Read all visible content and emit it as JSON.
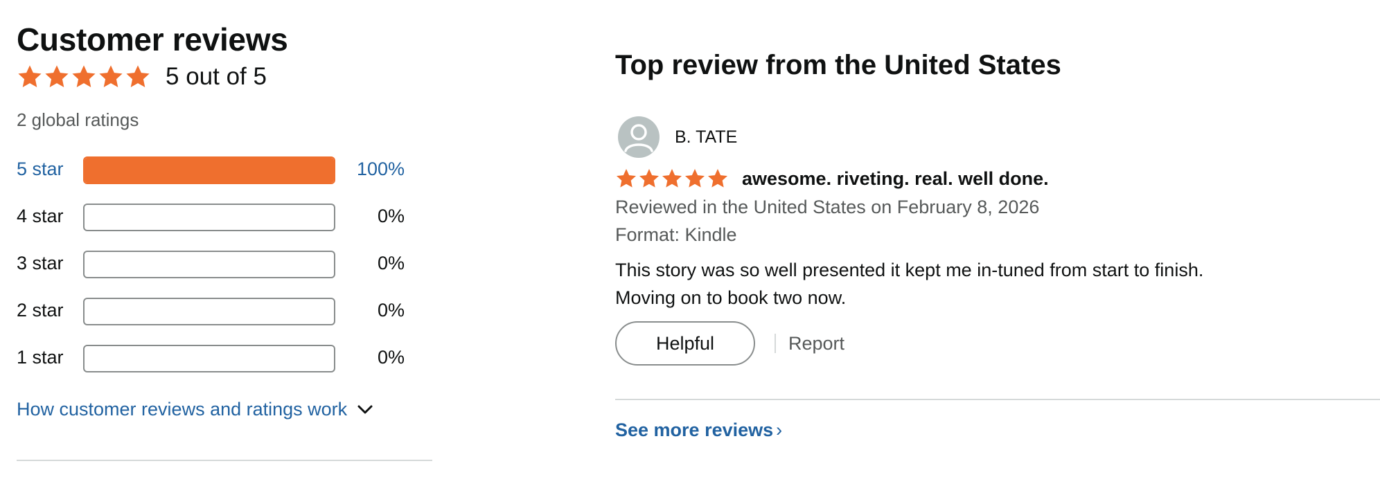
{
  "summary": {
    "title": "Customer reviews",
    "rating_value": 5,
    "rating_max": 5,
    "rating_text": "5 out of 5",
    "global_ratings": "2 global ratings",
    "star_color": "#ef6f2e"
  },
  "histogram": [
    {
      "label": "5 star",
      "percent": 100,
      "percent_text": "100%"
    },
    {
      "label": "4 star",
      "percent": 0,
      "percent_text": "0%"
    },
    {
      "label": "3 star",
      "percent": 0,
      "percent_text": "0%"
    },
    {
      "label": "2 star",
      "percent": 0,
      "percent_text": "0%"
    },
    {
      "label": "1 star",
      "percent": 0,
      "percent_text": "0%"
    }
  ],
  "how_link": "How customer reviews and ratings work",
  "top_review": {
    "section_title": "Top review from the United States",
    "reviewer": "B. TATE",
    "avatar_icon": "user-silhouette-icon",
    "stars": 5,
    "headline": "awesome. riveting. real. well done.",
    "reviewed_in": "Reviewed in the United States on February 8, 2026",
    "format": "Format: Kindle",
    "body_lines": [
      "This story was so well presented it kept me in-tuned from start to finish.",
      "Moving on to book two now."
    ],
    "helpful_label": "Helpful",
    "report_label": "Report"
  },
  "see_more": {
    "label": "See more reviews",
    "caret": "›"
  },
  "colors": {
    "link": "#2162a1",
    "muted": "#565959",
    "bar_fill": "#ef6f2e",
    "divider": "#d5d9d9"
  }
}
